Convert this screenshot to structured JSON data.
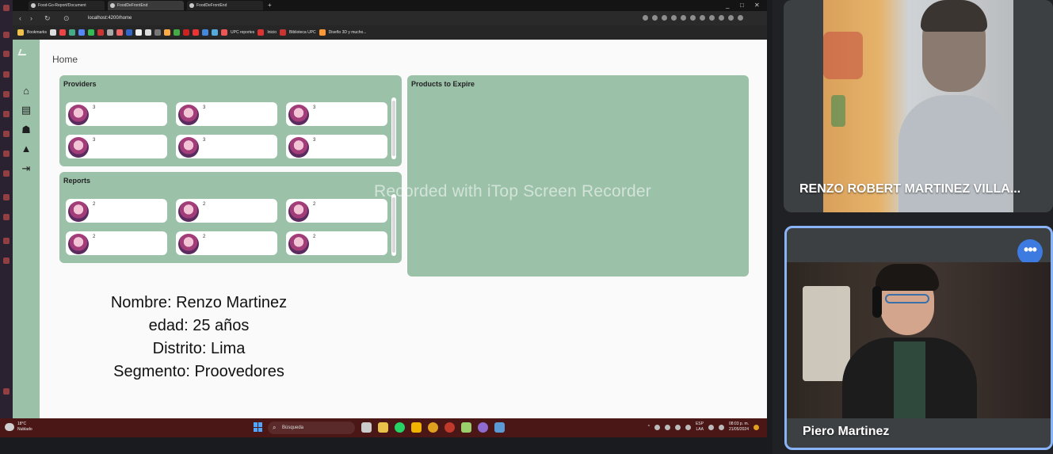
{
  "browser": {
    "tabs": [
      {
        "label": "Food-Go-Report/Document"
      },
      {
        "label": "FoodDeFrontEnd"
      },
      {
        "label": "FoodDeFrontEnd"
      }
    ],
    "url": "localhost:4200/home",
    "bookmarks": [
      "Bookmarks",
      "UPC reportes",
      "Inicio",
      "Biblioteca UPC",
      "Diseño 3D y mucho..."
    ]
  },
  "app": {
    "breadcrumb": "Home",
    "sidebar_icons": [
      "home-icon",
      "archive-icon",
      "people-icon",
      "bell-icon",
      "logout-icon"
    ],
    "providers": {
      "title": "Providers",
      "cards": [
        {
          "count": "3"
        },
        {
          "count": "3"
        },
        {
          "count": "3"
        },
        {
          "count": "3"
        },
        {
          "count": "3"
        },
        {
          "count": "3"
        }
      ]
    },
    "reports": {
      "title": "Reports",
      "cards": [
        {
          "count": "2"
        },
        {
          "count": "2"
        },
        {
          "count": "2"
        },
        {
          "count": "2"
        },
        {
          "count": "2"
        },
        {
          "count": "2"
        }
      ]
    },
    "products_to_expire": {
      "title": "Products to Expire"
    }
  },
  "profile": {
    "name": "Nombre: Renzo Martinez",
    "age": "edad: 25 años",
    "district": "Distrito: Lima",
    "segment": "Segmento: Proovedores"
  },
  "watermark": "Recorded with iTop Screen Recorder",
  "taskbar": {
    "weather_line1": "18°C",
    "weather_line2": "Nublado",
    "search_placeholder": "Búsqueda",
    "lang_line1": "ESP",
    "lang_line2": "LAA",
    "time": "08:03 p. m.",
    "date": "21/05/2024"
  },
  "meeting": {
    "participants": [
      {
        "name": "RENZO ROBERT MARTINEZ VILLA..."
      },
      {
        "name": "Piero Martinez"
      }
    ],
    "more_options_glyph": "•••",
    "active_speaker_color": "#8ab4f8"
  },
  "colors": {
    "app_green": "#9bc1a9",
    "taskbar": "#4a1616",
    "meet_accent": "#3d7be0"
  }
}
